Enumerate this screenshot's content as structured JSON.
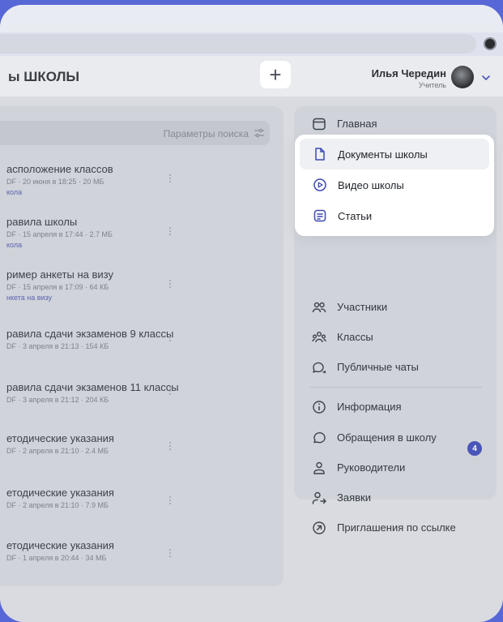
{
  "header": {
    "title": "ы ШКОЛЫ",
    "add_label": "+",
    "user": {
      "name": "Илья Чередин",
      "role": "Учитель"
    }
  },
  "search": {
    "placeholder": "Параметры поиска"
  },
  "documents": [
    {
      "title": "асположение классов",
      "meta": "DF · 20 июня в 18:25 · 20 МБ",
      "tag": "кола"
    },
    {
      "title": "равила школы",
      "meta": "DF · 15 апреля в 17:44 · 2.7 МБ",
      "tag": "кола"
    },
    {
      "title": "ример анкеты на визу",
      "meta": "DF · 15 апреля в 17:09 · 64 КБ",
      "tag": "нкета на визу"
    },
    {
      "title": "равила сдачи экзаменов 9 классы",
      "meta": "DF · 3 апреля в 21:13 · 154 КБ",
      "tag": ""
    },
    {
      "title": "равила сдачи экзаменов 11 классы",
      "meta": "DF · 3 апреля в 21:12 · 204 КБ",
      "tag": ""
    },
    {
      "title": "етодические указания",
      "meta": "DF · 2 апреля в 21:10 · 2.4 МБ",
      "tag": ""
    },
    {
      "title": "етодические указания",
      "meta": "DF · 2 апреля в 21:10 · 7.9 МБ",
      "tag": ""
    },
    {
      "title": "етодические указания",
      "meta": "DF · 1 апреля в 20:44 · 34 МБ",
      "tag": ""
    }
  ],
  "menu": {
    "home": "Главная",
    "submenu": [
      "Документы школы",
      "Видео школы",
      "Статьи"
    ],
    "group1": [
      "Участники",
      "Классы",
      "Публичные чаты"
    ],
    "group2": [
      "Информация",
      "Обращения в школу",
      "Руководители",
      "Заявки",
      "Приглашения по ссылке"
    ],
    "requests_badge": "4"
  },
  "colors": {
    "accent": "#4a56b8",
    "background": "#5867d6"
  },
  "icons": {
    "home": "window-icon",
    "documents": "document-icon",
    "video": "play-circle-icon",
    "articles": "article-icon",
    "members": "users-icon",
    "classes": "group-icon",
    "chats": "chat-bubbles-icon",
    "info": "info-icon",
    "appeals": "speech-bubble-icon",
    "leaders": "person-icon",
    "requests": "person-arrow-icon",
    "invites": "arrow-circle-icon"
  }
}
